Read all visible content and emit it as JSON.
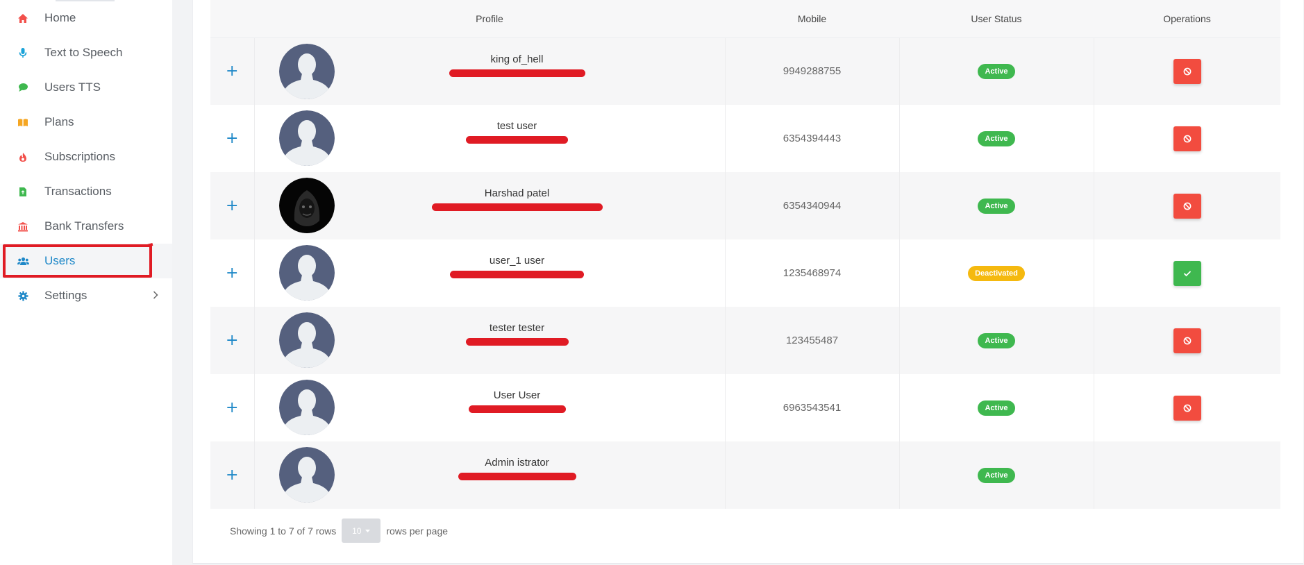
{
  "sidebar": {
    "items": [
      {
        "label": "Home",
        "icon": "home-icon",
        "color": "#f2504b"
      },
      {
        "label": "Text to Speech",
        "icon": "microphone-icon",
        "color": "#1aa3d9"
      },
      {
        "label": "Users TTS",
        "icon": "chat-icon",
        "color": "#3fb84f"
      },
      {
        "label": "Plans",
        "icon": "book-icon",
        "color": "#f5a623"
      },
      {
        "label": "Subscriptions",
        "icon": "fire-icon",
        "color": "#f2504b"
      },
      {
        "label": "Transactions",
        "icon": "file-icon",
        "color": "#3fb84f"
      },
      {
        "label": "Bank Transfers",
        "icon": "bank-icon",
        "color": "#f2504b"
      },
      {
        "label": "Users",
        "icon": "users-icon",
        "color": "#1e88c8"
      },
      {
        "label": "Settings",
        "icon": "gear-icon",
        "color": "#1e88c8"
      }
    ],
    "active": "Users"
  },
  "table": {
    "headers": {
      "profile": "Profile",
      "mobile": "Mobile",
      "status": "User Status",
      "operations": "Operations"
    },
    "rows": [
      {
        "name": "king of_hell",
        "mobile": "9949288755",
        "status": "Active",
        "avatar": "default",
        "op": "ban"
      },
      {
        "name": "test user",
        "mobile": "6354394443",
        "status": "Active",
        "avatar": "default",
        "op": "ban"
      },
      {
        "name": "Harshad patel",
        "mobile": "6354340944",
        "status": "Active",
        "avatar": "dark",
        "op": "ban"
      },
      {
        "name": "user_1 user",
        "mobile": "1235468974",
        "status": "Deactivated",
        "avatar": "default",
        "op": "activate"
      },
      {
        "name": "tester tester",
        "mobile": "123455487",
        "status": "Active",
        "avatar": "default",
        "op": "ban"
      },
      {
        "name": "User User",
        "mobile": "6963543541",
        "status": "Active",
        "avatar": "default",
        "op": "ban"
      },
      {
        "name": "Admin istrator",
        "mobile": "",
        "status": "Active",
        "avatar": "default",
        "op": "none"
      }
    ],
    "expand_symbol": "+"
  },
  "footer": {
    "showing": "Showing 1 to 7 of 7 rows",
    "page_size": "10",
    "rows_per_page": "rows per page"
  },
  "colors": {
    "accent": "#1e88c8",
    "active_badge": "#3fb84f",
    "deactivated_badge": "#f5b90f",
    "ban_button": "#f24c3f",
    "redaction": "#e01b24"
  }
}
